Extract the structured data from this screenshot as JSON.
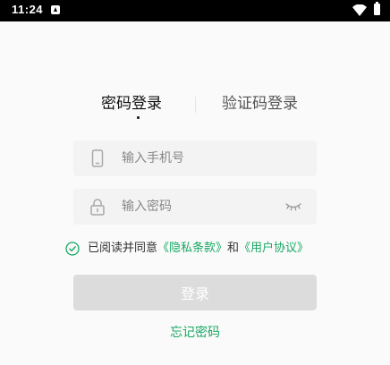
{
  "status_bar": {
    "time": "11:24",
    "icons": [
      "notification-icon",
      "wifi-icon",
      "battery-icon"
    ]
  },
  "tabs": [
    {
      "label": "密码登录",
      "active": true
    },
    {
      "label": "验证码登录",
      "active": false
    }
  ],
  "phone_field": {
    "icon": "phone-icon",
    "placeholder": "输入手机号",
    "value": ""
  },
  "password_field": {
    "icon": "lock-icon",
    "placeholder": "输入密码",
    "value": "",
    "toggle_icon": "eye-closed-icon"
  },
  "agreement": {
    "prefix": "已阅读并同意",
    "privacy_link": "《隐私条款》",
    "conjunction": "和",
    "user_link": "《用户协议》",
    "checked": true
  },
  "login_button": {
    "label": "登录",
    "enabled": false
  },
  "forgot_password": {
    "label": "忘记密码"
  },
  "colors": {
    "accent": "#18a864",
    "button_disabled": "#dcdcdc",
    "field_bg": "#f3f3f3",
    "background": "#fafafa"
  }
}
